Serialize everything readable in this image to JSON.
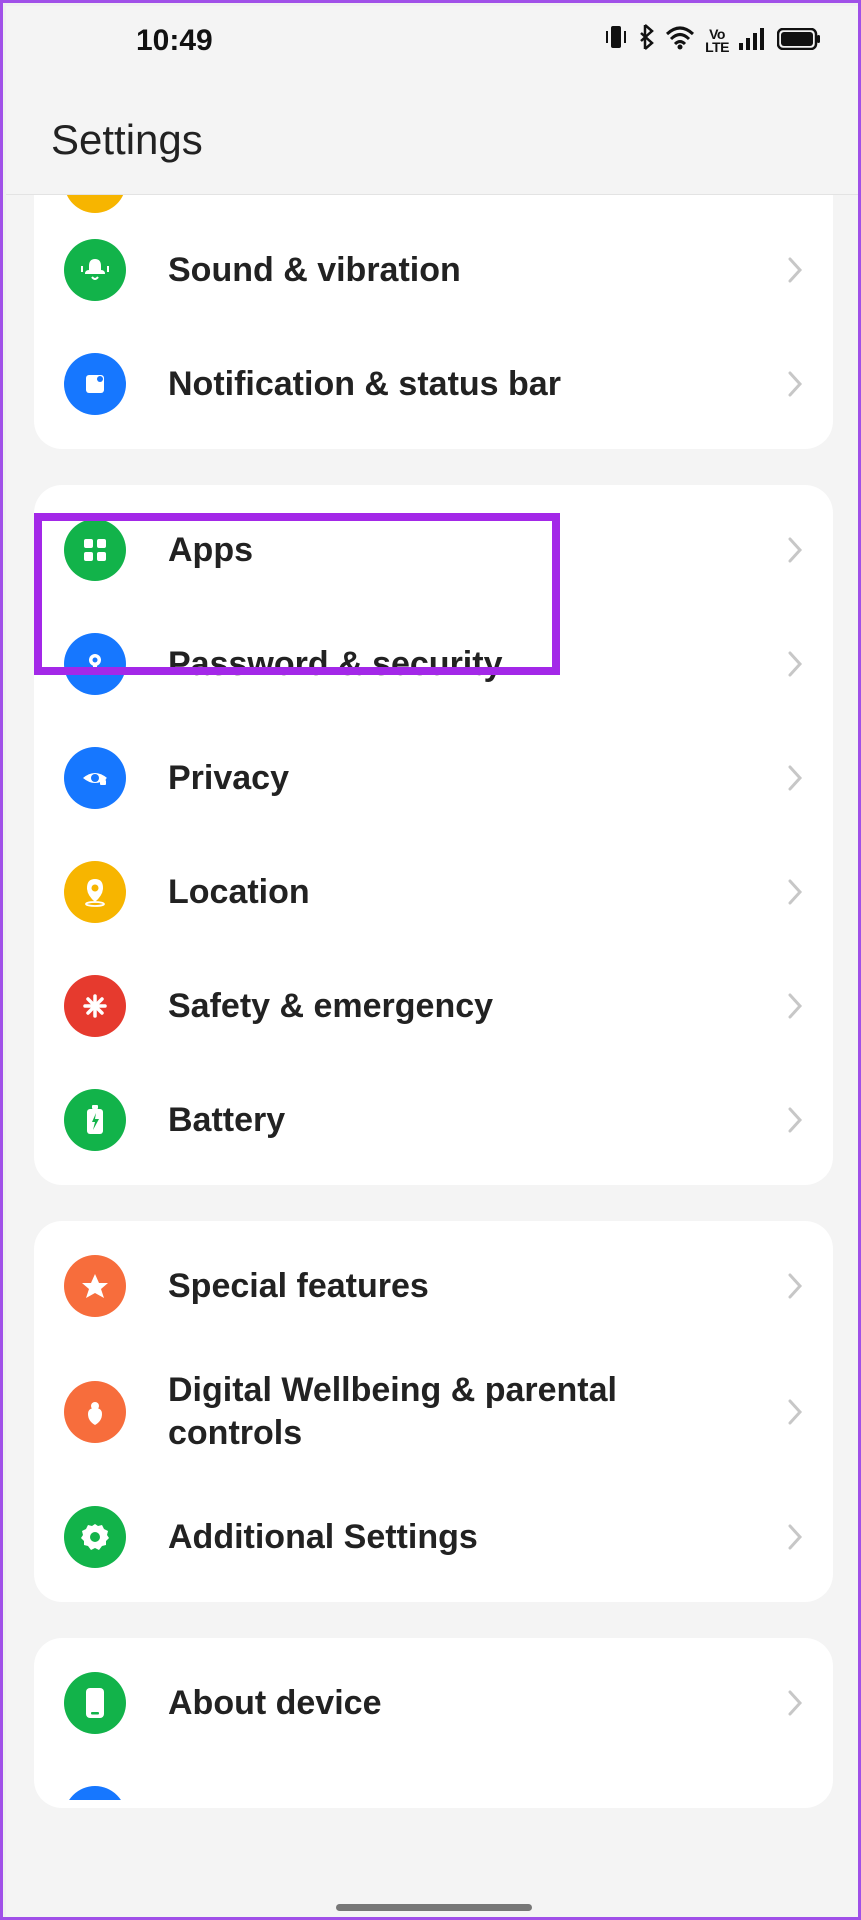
{
  "status": {
    "time": "10:49",
    "volte": "Vo\nLTE"
  },
  "header": {
    "title": "Settings"
  },
  "items": {
    "sound": {
      "label": "Sound & vibration",
      "color": "#12b34a"
    },
    "notif": {
      "label": "Notification & status bar",
      "color": "#1677ff"
    },
    "apps": {
      "label": "Apps",
      "color": "#12b34a"
    },
    "password": {
      "label": "Password & security",
      "color": "#1677ff"
    },
    "privacy": {
      "label": "Privacy",
      "color": "#1677ff"
    },
    "location": {
      "label": "Location",
      "color": "#f7b500"
    },
    "safety": {
      "label": "Safety & emergency",
      "color": "#e63a2e"
    },
    "battery": {
      "label": "Battery",
      "color": "#12b34a"
    },
    "special": {
      "label": "Special features",
      "color": "#f76d3c"
    },
    "digital": {
      "label": "Digital Wellbeing & parental controls",
      "color": "#f76d3c"
    },
    "additional": {
      "label": "Additional Settings",
      "color": "#12b34a"
    },
    "about": {
      "label": "About device",
      "color": "#12b34a"
    }
  }
}
